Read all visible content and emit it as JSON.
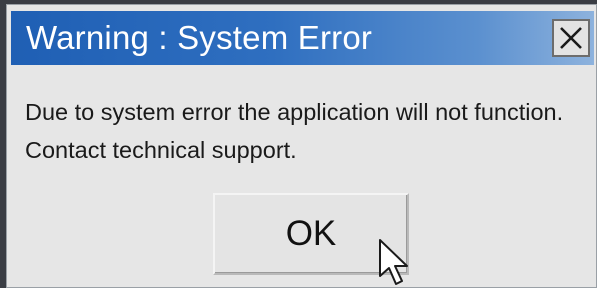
{
  "dialog": {
    "title": "Warning : System Error",
    "close_icon": "close-x-icon",
    "message_lines": [
      "Due to system error the application will not function.",
      "Contact technical support."
    ],
    "ok_label": "OK"
  },
  "cursor": {
    "icon": "mouse-pointer-icon"
  },
  "colors": {
    "titlebar_start": "#1f5fb4",
    "titlebar_end": "#8db2dd",
    "dialog_background": "#e6e6e6"
  }
}
